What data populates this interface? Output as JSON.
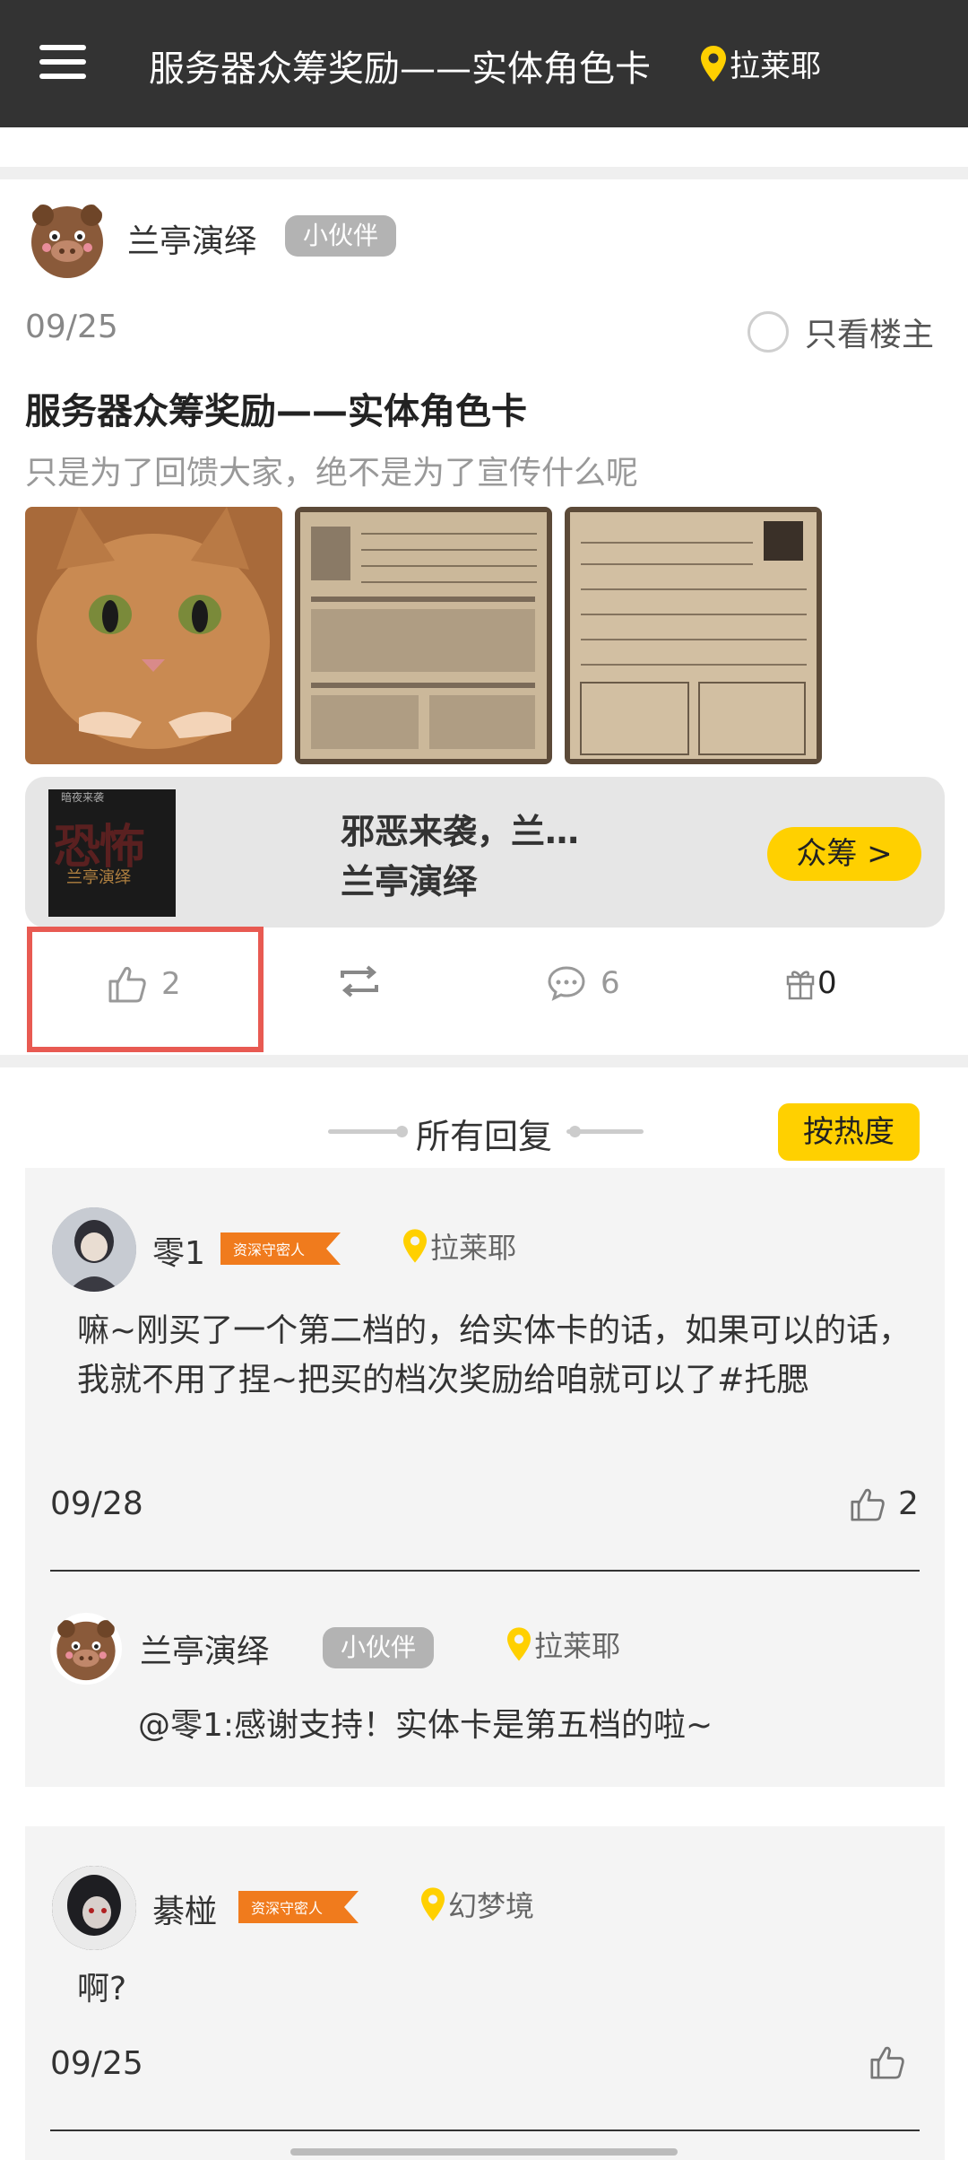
{
  "header": {
    "title": "服务器众筹奖励——实体角色卡",
    "location": "拉莱耶"
  },
  "post": {
    "author": "兰亭演绎",
    "author_badge": "小伙伴",
    "date": "09/25",
    "only_host_label": "只看楼主",
    "title": "服务器众筹奖励——实体角色卡",
    "subtitle": "只是为了回馈大家，绝不是为了宣传什么呢",
    "crowdfund": {
      "cover_title": "恐怖",
      "cover_top": "暗夜来袭",
      "cover_sub": "兰亭演绎",
      "line1": "邪恶来袭，兰…",
      "line2": "兰亭演绎",
      "button": "众筹 >"
    },
    "actions": {
      "likes": "2",
      "comments": "6",
      "gifts": "0"
    }
  },
  "replies_section": {
    "title": "所有回复",
    "sort_button": "按热度"
  },
  "replies": [
    {
      "name": "零1",
      "badge": "资深守密人",
      "location": "拉莱耶",
      "text": "嘛~刚买了一个第二档的，给实体卡的话，如果可以的话，我就不用了捏~把买的档次奖励给咱就可以了#托腮",
      "date": "09/28",
      "likes": "2",
      "sub_reply": {
        "name": "兰亭演绎",
        "badge": "小伙伴",
        "location": "拉莱耶",
        "text": "@零1:感谢支持！实体卡是第五档的啦~"
      }
    },
    {
      "name": "綦椪",
      "badge": "资深守密人",
      "location": "幻梦境",
      "text": "啊?",
      "date": "09/25",
      "likes": ""
    }
  ],
  "colors": {
    "topbar": "#333333",
    "accent_yellow": "#ffd000",
    "badge_orange": "#f07b1d",
    "highlight_red": "#e85a52"
  }
}
